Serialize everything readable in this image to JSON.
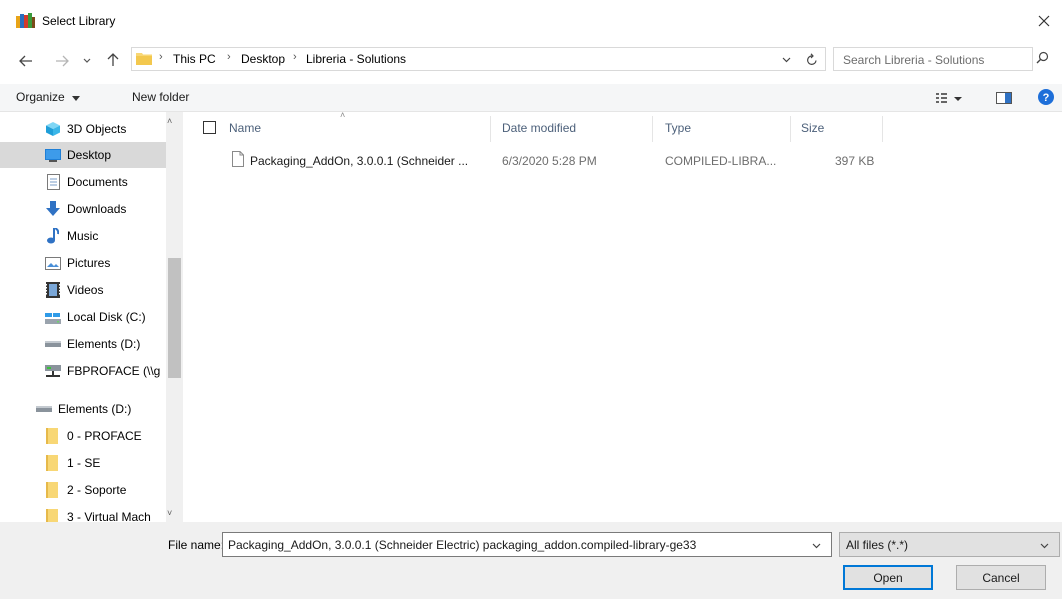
{
  "window": {
    "title": "Select Library",
    "icons": {
      "app": "books-icon",
      "close": "close-icon"
    }
  },
  "address": {
    "breadcrumbs": [
      "This PC",
      "Desktop",
      "Libreria - Solutions"
    ],
    "search_placeholder": "Search Libreria - Solutions"
  },
  "toolbar": {
    "organize_label": "Organize",
    "new_folder_label": "New folder"
  },
  "sidebar": {
    "items": [
      {
        "label": "3D Objects",
        "icon": "3d-objects-icon"
      },
      {
        "label": "Desktop",
        "icon": "desktop-icon",
        "selected": true
      },
      {
        "label": "Documents",
        "icon": "documents-icon"
      },
      {
        "label": "Downloads",
        "icon": "download-icon"
      },
      {
        "label": "Music",
        "icon": "music-icon"
      },
      {
        "label": "Pictures",
        "icon": "pictures-icon"
      },
      {
        "label": "Videos",
        "icon": "videos-icon"
      },
      {
        "label": "Local Disk (C:)",
        "icon": "local-disk-icon"
      },
      {
        "label": "Elements (D:)",
        "icon": "drive-icon"
      },
      {
        "label": "FBPROFACE (\\\\g",
        "icon": "network-drive-icon"
      },
      {
        "label": "Elements (D:)",
        "icon": "drive-icon"
      },
      {
        "label": "0 - PROFACE",
        "icon": "folder-icon"
      },
      {
        "label": "1 - SE",
        "icon": "folder-icon"
      },
      {
        "label": "2 - Soporte",
        "icon": "folder-icon"
      },
      {
        "label": "3 - Virtual Mach",
        "icon": "folder-icon"
      }
    ]
  },
  "columns": [
    "Name",
    "Date modified",
    "Type",
    "Size"
  ],
  "files": [
    {
      "name": "Packaging_AddOn, 3.0.0.1 (Schneider ...",
      "date_modified": "6/3/2020 5:28 PM",
      "type": "COMPILED-LIBRA...",
      "size": "397 KB"
    }
  ],
  "footer": {
    "file_name_label": "File name:",
    "file_name_value": "Packaging_AddOn, 3.0.0.1 (Schneider Electric)  packaging_addon.compiled-library-ge33",
    "filter_value": "All files (*.*)",
    "open_label": "Open",
    "cancel_label": "Cancel"
  },
  "colors": {
    "accent": "#0078d7",
    "selected_bg": "#d9d9d9",
    "folder": "#f8d775",
    "header_text": "#4c607a",
    "help": "#1e6fd9"
  }
}
